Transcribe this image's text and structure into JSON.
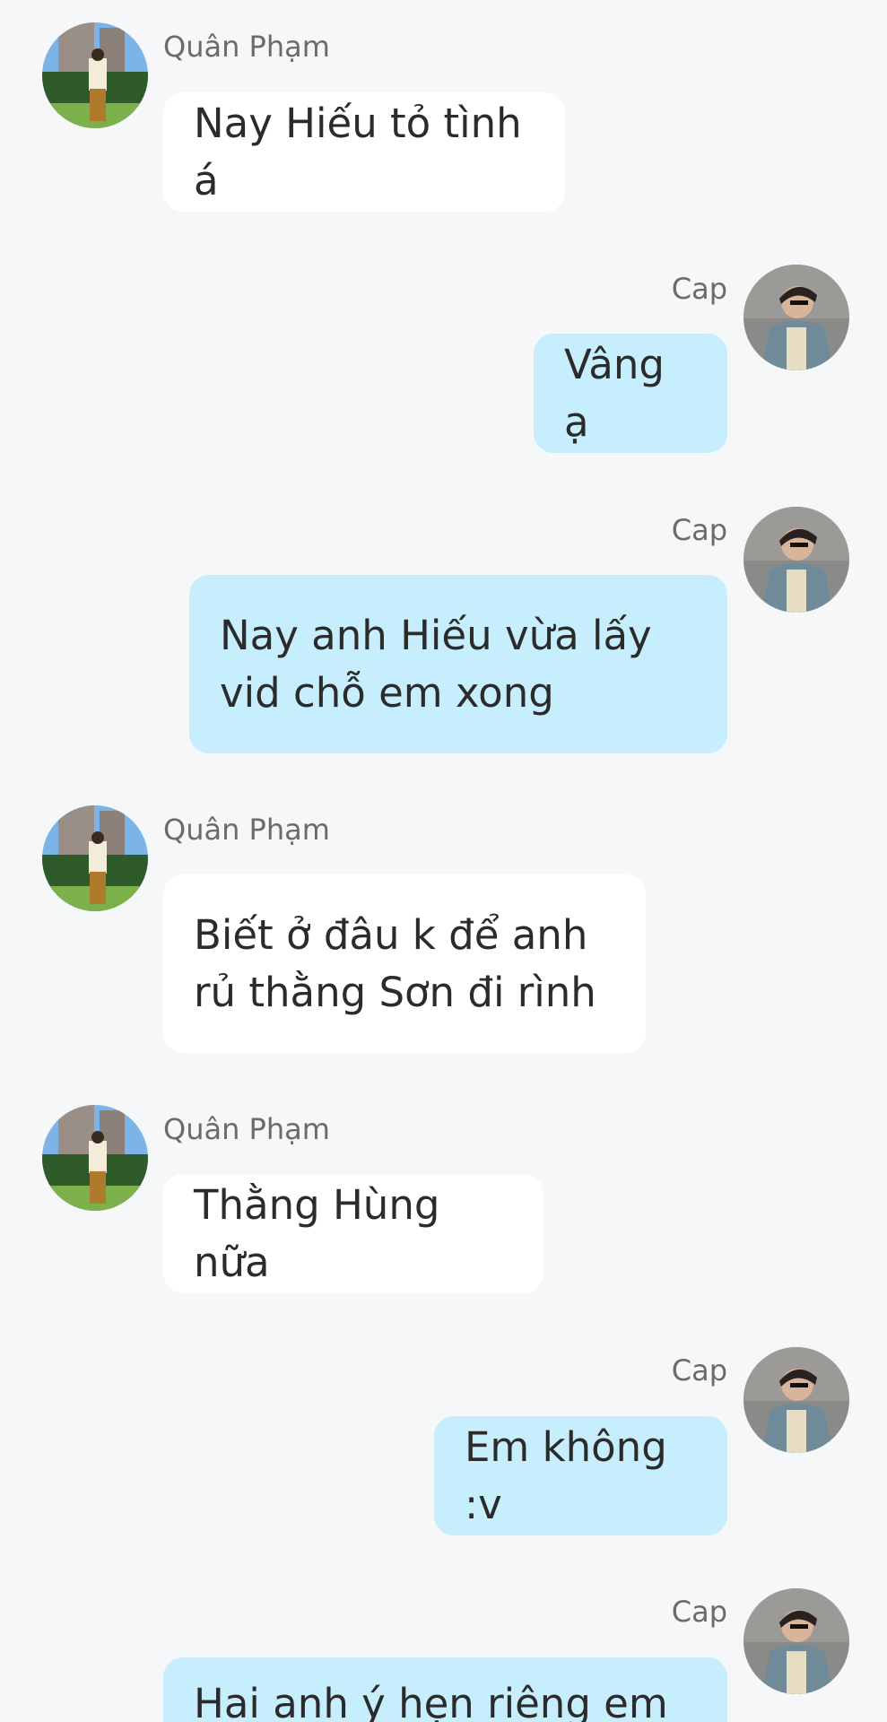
{
  "conversation": {
    "messages": [
      {
        "sender": "Quân Phạm",
        "side": "in",
        "text": "Nay Hiếu tỏ tình á",
        "avatar_icon": "user-avatar-icon"
      },
      {
        "sender": "Cap",
        "side": "out",
        "text": "Vâng ạ",
        "avatar_icon": "user-avatar-icon"
      },
      {
        "sender": "Cap",
        "side": "out",
        "text": "Nay anh Hiếu vừa lấy vid chỗ em xong",
        "avatar_icon": "user-avatar-icon"
      },
      {
        "sender": "Quân Phạm",
        "side": "in",
        "text": "Biết ở đâu k để anh rủ thằng Sơn đi rình",
        "avatar_icon": "user-avatar-icon"
      },
      {
        "sender": "Quân Phạm",
        "side": "in",
        "text": "Thằng Hùng nữa",
        "avatar_icon": "user-avatar-icon"
      },
      {
        "sender": "Cap",
        "side": "out",
        "text": "Em không :v",
        "avatar_icon": "user-avatar-icon"
      },
      {
        "sender": "Cap",
        "side": "out",
        "text": "Hai anh ý hẹn riêng em chỉ",
        "avatar_icon": "user-avatar-icon"
      }
    ]
  },
  "colors": {
    "background": "#f5f7f9",
    "incoming_bubble": "#ffffff",
    "outgoing_bubble": "#c7eefd",
    "sender_name": "#6b6b6b",
    "message_text": "#2b2b2b"
  }
}
